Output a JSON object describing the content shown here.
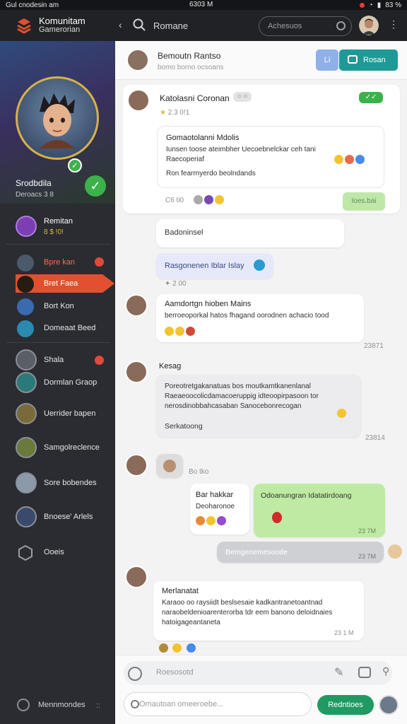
{
  "status_bar": {
    "left": "Gul cnodesin am",
    "center": "6303 M",
    "right": "83 %"
  },
  "topbar": {
    "brand_title": "Komunitam",
    "brand_sub": "Gamerorian",
    "title": "Romane",
    "search_placeholder": "Achesuos"
  },
  "sidebar": {
    "profile_name": "Srodbdila",
    "profile_sub": "Deroacs 3 8",
    "user_name": "Remitan",
    "user_sub": "8 $ !0!",
    "nav": [
      {
        "label": "Bpre kan",
        "badge": true
      },
      {
        "label": "Bret Faea",
        "active": true
      },
      {
        "label": "Bort Kon"
      },
      {
        "label": "Domeaat Beed"
      }
    ],
    "contacts": [
      {
        "label": "Shala",
        "badge": true
      },
      {
        "label": "Dormlan Graop"
      },
      {
        "label": "Uerrider bapen"
      },
      {
        "label": "Samgolreclence"
      },
      {
        "label": "Sore bobendes"
      },
      {
        "label": "Bnoese' Arlels"
      },
      {
        "label": "Ooeis"
      }
    ],
    "footer_label": "Mennmondes",
    "footer_grid": "::"
  },
  "conversation": {
    "header_name": "Bemoutn Rantso",
    "header_status": "bomo borno ocsoans",
    "btn_small": "Li",
    "btn_primary": "Rosan",
    "messages": [
      {
        "id": "m1",
        "name": "Katolasni Coronan",
        "tag": "○ ○",
        "meta": "2.3   0!1",
        "quote_title": "Gomaotolanni Mdolis",
        "quote_body": "Iunsen toose ateimbher Uecoebnelckar ceh tani Raecoperiaf",
        "quote_extra": "Ron fearrnyerdo beolndands",
        "reactions": "C6 ti0",
        "tag_right": "Ioes.bai"
      },
      {
        "id": "m2",
        "text": "Badoninsel"
      },
      {
        "id": "m3",
        "text": "Rasgonenen Iblar Islay",
        "meta": "✦ 2   00"
      },
      {
        "id": "m4",
        "name": "Aamdortgn hioben Mains",
        "body": "berroeoporkal hatos fhagand oorodnen achacio tood",
        "time": "23871"
      },
      {
        "id": "m5",
        "name": "Kesag",
        "body": "Poreotretgakanatuas bos moutkamtkanenlanal Raeaeoocolicdamacoeruppig idteoopirpasoon tor nerosdinobbahcasaban Sanocebonrecogan",
        "extra": "Serkatoong",
        "time": "23814"
      },
      {
        "id": "m6",
        "meta": "Bo tko"
      },
      {
        "id": "m7",
        "name": "Bar hakkar",
        "body": "Deoharonoe",
        "green": "Odoanungran Idatatirdoang",
        "time": "23 7M"
      },
      {
        "id": "m8",
        "text": "Bemgenemesoode",
        "time": "23 7M"
      },
      {
        "id": "m9",
        "name": "Merlanatat",
        "body": "Karaoo oo raysiidt beslsesaie kadkantranetoantnad naraobeldenioarenterorba tdr eem banono deloidnaies hatoigageantaneta",
        "time": "23 1 M"
      }
    ],
    "input_placeholder": "Roesosotd",
    "compose_placeholder": "Omautoan omeeroebe...",
    "send_label": "Redntioes"
  }
}
